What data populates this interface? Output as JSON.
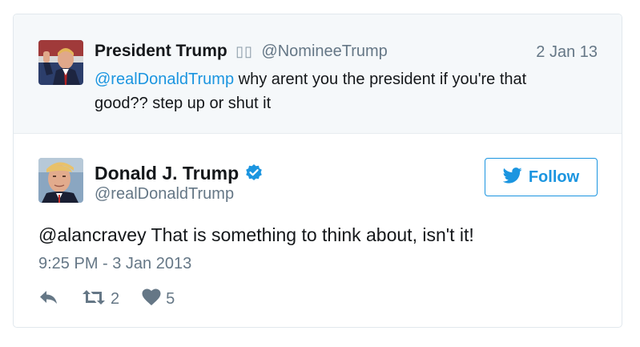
{
  "parent_tweet": {
    "author_name": "President Trump",
    "author_flags": "▯▯",
    "author_handle": "@NomineeTrump",
    "date": "2 Jan 13",
    "text_mention": "@realDonaldTrump",
    "text_body": " why arent you the president if you're that good?? step up or shut it"
  },
  "tweet": {
    "author_name": "Donald J. Trump",
    "author_handle": "@realDonaldTrump",
    "verified": true,
    "text": "@alancravey That is something to think about, isn't it!",
    "timestamp": "9:25 PM - 3 Jan 2013",
    "retweets": "2",
    "likes": "5"
  },
  "follow_button": {
    "label": "Follow",
    "icon": "twitter-bird-icon"
  },
  "icons": {
    "reply": "reply-icon",
    "retweet": "retweet-icon",
    "like": "heart-icon",
    "verified": "verified-badge-icon"
  },
  "colors": {
    "accent": "#1b95e0",
    "muted": "#657786",
    "text": "#14171a",
    "parent_bg": "#f5f8fa",
    "border": "#e1e8ed"
  }
}
